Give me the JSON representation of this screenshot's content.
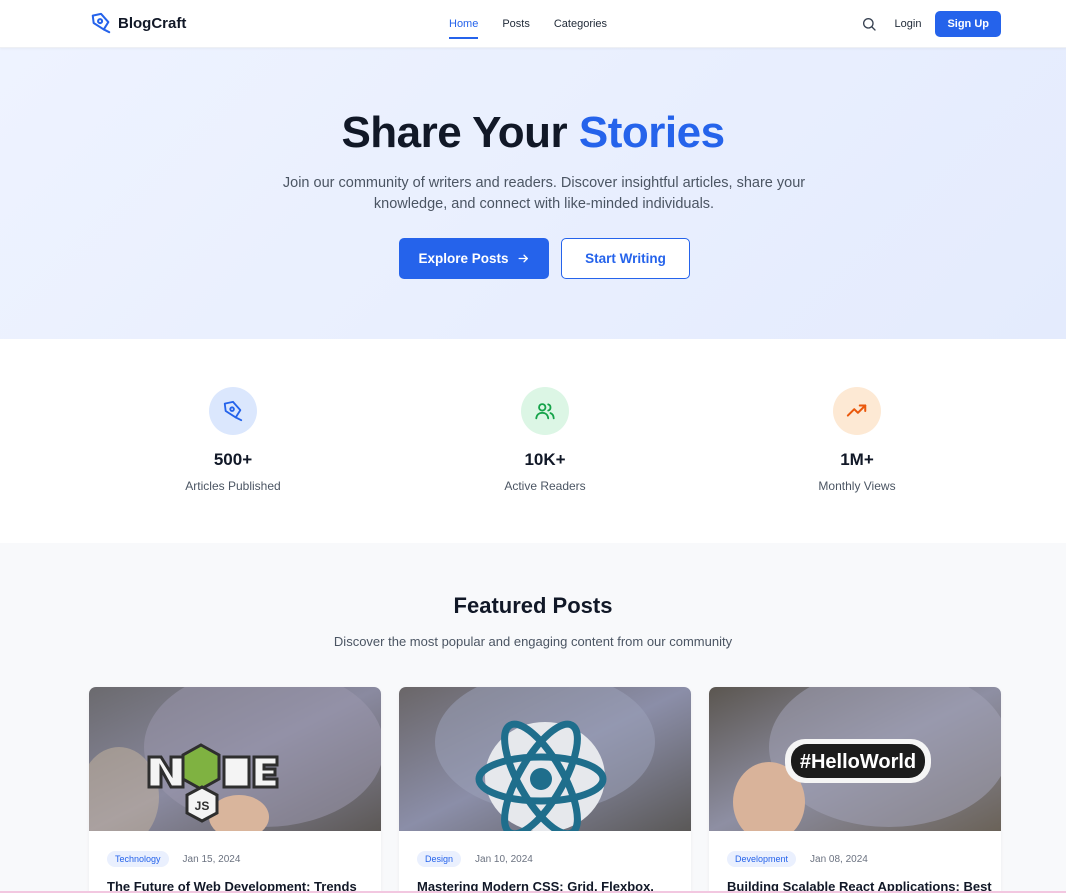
{
  "nav": {
    "brand": "BlogCraft",
    "links": [
      {
        "label": "Home",
        "active": true
      },
      {
        "label": "Posts",
        "active": false
      },
      {
        "label": "Categories",
        "active": false
      }
    ],
    "login": "Login",
    "signup": "Sign Up"
  },
  "hero": {
    "title_main": "Share Your",
    "title_accent": "Stories",
    "subtitle": "Join our community of writers and readers. Discover insightful articles, share your knowledge, and connect with like-minded individuals.",
    "primary_button": "Explore Posts",
    "secondary_button": "Start Writing"
  },
  "stats": [
    {
      "value": "500+",
      "label": "Articles Published",
      "icon": "pen-nib-icon",
      "color": "#2563eb",
      "bg": "#dbe7fd"
    },
    {
      "value": "10K+",
      "label": "Active Readers",
      "icon": "users-icon",
      "color": "#16a34a",
      "bg": "#dcf6e5"
    },
    {
      "value": "1M+",
      "label": "Monthly Views",
      "icon": "trending-up-icon",
      "color": "#ea580c",
      "bg": "#fde9d4"
    }
  ],
  "featured": {
    "title": "Featured Posts",
    "subtitle": "Discover the most popular and engaging content from our community",
    "posts": [
      {
        "tag": "Technology",
        "date": "Jan 15, 2024",
        "title": "The Future of Web Development: Trends",
        "image": "node-js-sticker"
      },
      {
        "tag": "Design",
        "date": "Jan 10, 2024",
        "title": "Mastering Modern CSS: Grid, Flexbox,",
        "image": "react-sticker"
      },
      {
        "tag": "Development",
        "date": "Jan 08, 2024",
        "title": "Building Scalable React Applications: Best",
        "image": "helloworld-sticker"
      }
    ]
  },
  "colors": {
    "accent": "#2563eb",
    "hero_bg": "#e8eefd",
    "section_bg": "#f8f9fb"
  }
}
